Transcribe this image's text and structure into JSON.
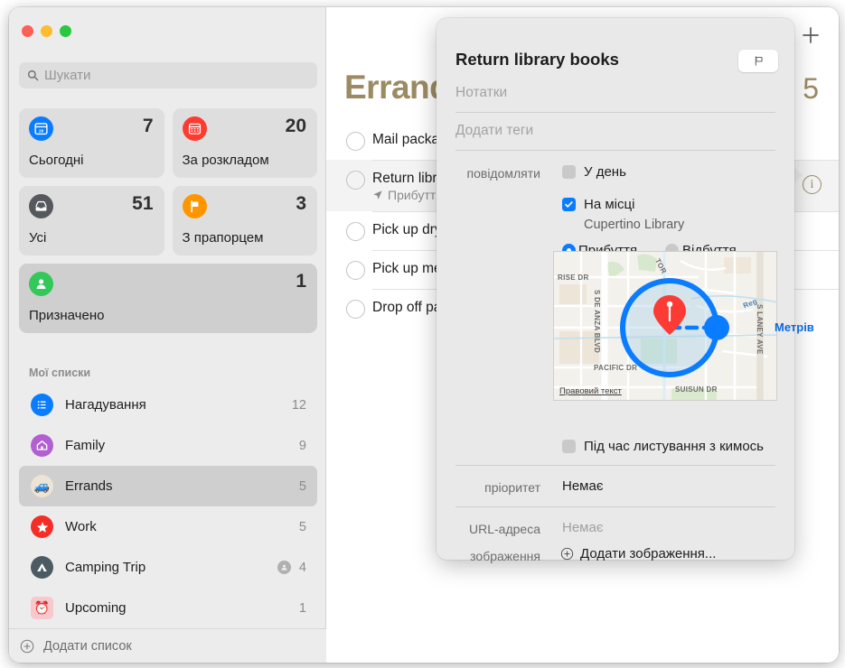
{
  "window": {
    "traffic_lights": [
      "close",
      "minimize",
      "zoom"
    ],
    "colors": {
      "accent": "#9c8a63",
      "blue": "#0a7cff",
      "sidebar_bg": "#ececec"
    }
  },
  "sidebar": {
    "search": {
      "placeholder": "Шукати",
      "icon": "search-icon"
    },
    "smart_tiles": [
      {
        "name": "Сьогодні",
        "count": "7",
        "icon": "calendar-today-icon",
        "icon_color": "#0a7cff",
        "badge": "29"
      },
      {
        "name": "За розкладом",
        "count": "20",
        "icon": "calendar-scheduled-icon",
        "icon_color": "#ff3b30"
      },
      {
        "name": "Усі",
        "count": "51",
        "icon": "inbox-all-icon",
        "icon_color": "#55595e"
      },
      {
        "name": "З прапорцем",
        "count": "3",
        "icon": "flag-icon",
        "icon_color": "#ff9500"
      },
      {
        "name": "Призначено",
        "count": "1",
        "icon": "person-assigned-icon",
        "icon_color": "#34c759",
        "selected": true
      }
    ],
    "section_label": "Мої списки",
    "lists": [
      {
        "name": "Нагадування",
        "count": "12",
        "icon": "list-bullet-icon",
        "icon_color": "#0a7cff",
        "selected": false,
        "shared": false
      },
      {
        "name": "Family",
        "count": "9",
        "icon": "house-icon",
        "icon_color": "#b25fd3",
        "selected": false,
        "shared": false
      },
      {
        "name": "Errands",
        "count": "5",
        "icon": "truck-icon",
        "icon_color": "#ece4d4",
        "selected": true,
        "shared": false
      },
      {
        "name": "Work",
        "count": "5",
        "icon": "star-icon",
        "icon_color": "#f42e27",
        "selected": false,
        "shared": false
      },
      {
        "name": "Camping Trip",
        "count": "4",
        "icon": "tent-icon",
        "icon_color": "#4c5a63",
        "selected": false,
        "shared": true
      },
      {
        "name": "Upcoming",
        "count": "1",
        "icon": "alarm-clock-icon",
        "icon_color": "#f9c8cc",
        "selected": false,
        "shared": false
      }
    ],
    "add_list": {
      "label": "Додати список",
      "icon": "plus-circle-icon"
    }
  },
  "main": {
    "add_button_icon": "plus-icon",
    "title": "Errands",
    "count": "5",
    "info_button_icon": "info-circle-icon",
    "tasks": [
      {
        "text": "Mail package",
        "sub": "",
        "selected": false
      },
      {
        "text": "Return library books",
        "sub": "Прибуття",
        "sub_icon": "location-arrow-icon",
        "selected": true
      },
      {
        "text": "Pick up dry cleaning",
        "sub": "",
        "selected": false
      },
      {
        "text": "Pick up medicine",
        "sub": "",
        "selected": false
      },
      {
        "text": "Drop off package",
        "sub": "",
        "selected": false
      }
    ]
  },
  "popover": {
    "title": "Return library books",
    "flag_button_icon": "flag-outline-icon",
    "notes_placeholder": "Нотатки",
    "tags_placeholder": "Додати теги",
    "notify_label": "повідомляти",
    "on_day": {
      "label": "У день",
      "checked": false
    },
    "at_location": {
      "label": "На місці",
      "checked": true,
      "value": "Cupertino Library"
    },
    "arrive": {
      "label": "Прибуття",
      "selected": true
    },
    "depart": {
      "label": "Відбуття",
      "selected": false
    },
    "messaging": {
      "label": "Під час листування з кимось",
      "checked": false
    },
    "priority": {
      "label": "пріоритет",
      "value": "Немає"
    },
    "url": {
      "label": "URL-адреса",
      "value": "Немає"
    },
    "image": {
      "label": "зображення",
      "add_label": "Додати зображення...",
      "icon": "plus-circle-icon"
    },
    "map": {
      "legal_text": "Правовий текст",
      "scale_label": "Метрів",
      "pin_icon": "map-pin-icon",
      "handle_icon": "radius-handle-icon",
      "street_labels": [
        "RISE DR",
        "S DE ANZA BLVD",
        "TOR",
        "PACIFIC  DR",
        "SUISUN DR",
        "Reg",
        "S LANEY AVE"
      ]
    }
  }
}
